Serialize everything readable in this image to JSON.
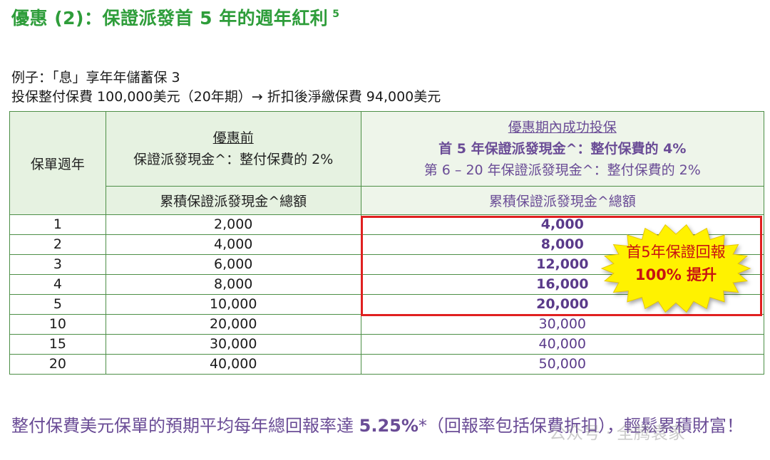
{
  "title": "優惠 (2)：保證派發首 5 年的週年紅利",
  "title_sup": "5",
  "example": {
    "line1": "例子：「息」享年年儲蓄保 3",
    "line2": "投保整付保費 100,000美元（20年期）→ 折扣後淨繳保費 94,000美元"
  },
  "table": {
    "col_year_header": "保單週年",
    "before": {
      "title": "優惠前",
      "desc": "保證派發現金^：整付保費的 2%",
      "sub": "累積保證派發現金^總額"
    },
    "promo": {
      "title": "優惠期內成功投保",
      "line1": "首 5 年保證派發現金^：整付保費的 4%",
      "line2": "第 6 – 20 年保證派發現金^：整付保費的 2%",
      "sub": "累積保證派發現金^總額"
    },
    "rows": [
      {
        "year": "1",
        "before": "2,000",
        "promo": "4,000"
      },
      {
        "year": "2",
        "before": "4,000",
        "promo": "8,000"
      },
      {
        "year": "3",
        "before": "6,000",
        "promo": "12,000"
      },
      {
        "year": "4",
        "before": "8,000",
        "promo": "16,000"
      },
      {
        "year": "5",
        "before": "10,000",
        "promo": "20,000"
      },
      {
        "year": "10",
        "before": "20,000",
        "promo": "30,000"
      },
      {
        "year": "15",
        "before": "30,000",
        "promo": "40,000"
      },
      {
        "year": "20",
        "before": "40,000",
        "promo": "50,000"
      }
    ]
  },
  "burst": {
    "line1": "首5年保證回報",
    "line2": "100% 提升",
    "fill_color": "#fff200",
    "text_color": "#c81212"
  },
  "footer": {
    "pre": "整付保費美元保單的預期平均每年總回報率達 ",
    "rate": "5.25%",
    "post": "*（回報率包括保費折扣），輕鬆累積財富！"
  },
  "watermark": "公众号 · 全腾袁家",
  "colors": {
    "title_green": "#2e9d3a",
    "promo_purple": "#6a4c96",
    "highlight_red": "#e02020",
    "table_border": "#4d8f47",
    "header_bg": "#e6f2e1"
  }
}
